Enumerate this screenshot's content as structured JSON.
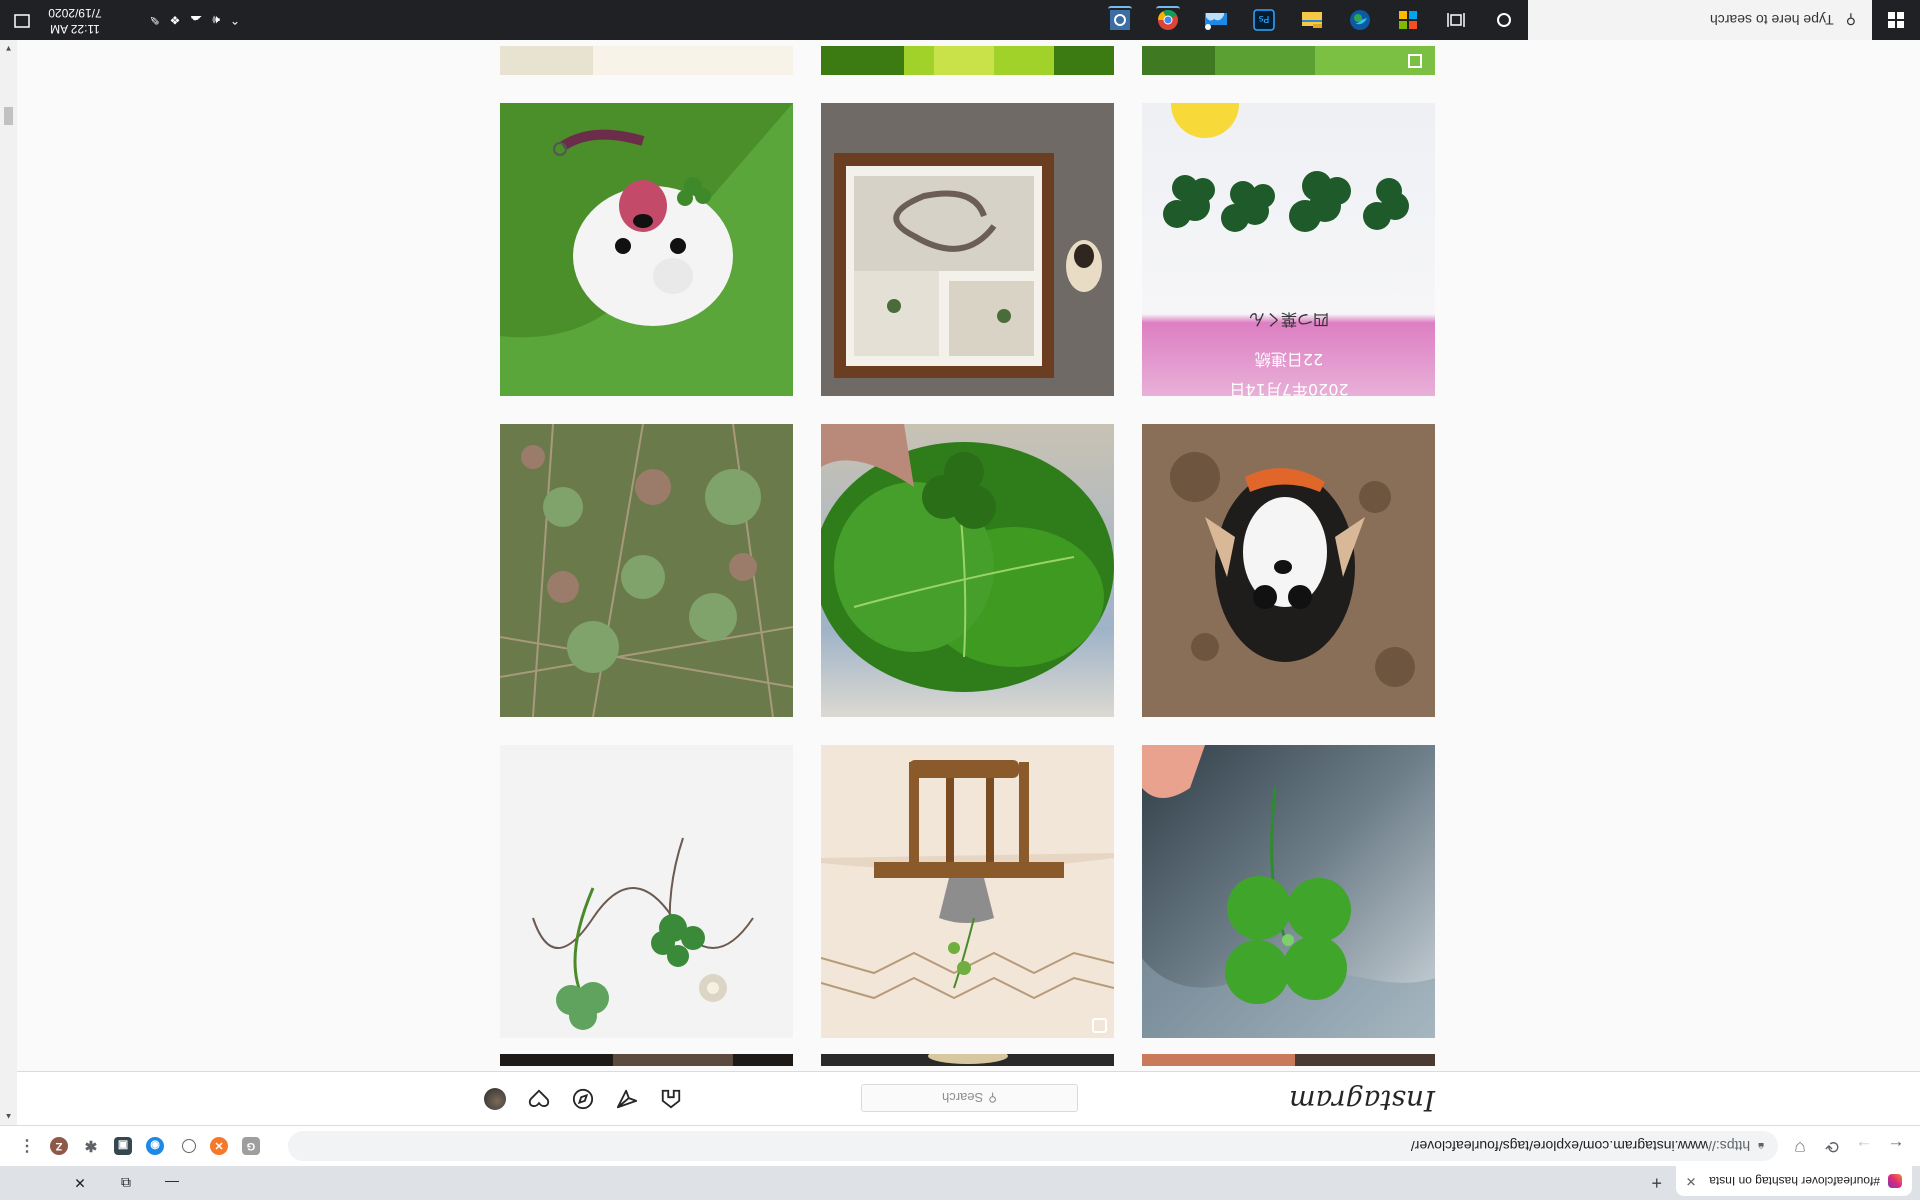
{
  "tab": {
    "title": "#fourleafclover hashtag on Insta",
    "close": "✕"
  },
  "window": {
    "minimize": "—",
    "restore": "⧉",
    "close": "✕",
    "newtab": "+"
  },
  "toolbar": {
    "back": "←",
    "forward": "→",
    "reload": "⟳",
    "url_protocol": "https://",
    "url_rest": "www.instagram.com/explore/tags/fourleafclover/",
    "menu": "⋮",
    "profile_initial": "Z"
  },
  "instagram": {
    "logo": "Instagram",
    "search_placeholder": "Search"
  },
  "tile_texts": {
    "line1": "2020年7月14日",
    "line2": "22日連続",
    "line3": "四つ葉くん"
  },
  "taskbar": {
    "search_placeholder": "Type here to search",
    "time": "11:22 AM",
    "date": "7/19/2020"
  },
  "icons": {
    "start": "windows-logo-icon",
    "cortana": "cortana-circle-icon",
    "taskview": "task-view-icon",
    "home": "home-icon",
    "direct": "direct-message-icon",
    "explore": "compass-icon",
    "activity": "heart-icon"
  }
}
